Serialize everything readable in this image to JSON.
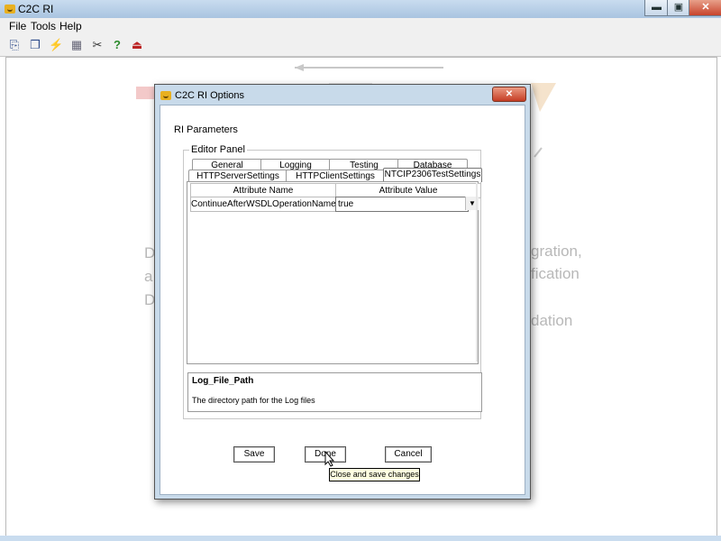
{
  "window": {
    "title": "C2C RI"
  },
  "titlebar_buttons": {
    "minimize": "▬",
    "maximize": "▣",
    "close": "✕"
  },
  "menu": {
    "items": [
      "File",
      "Tools",
      "Help"
    ]
  },
  "toolbar": {
    "icons": [
      "open-icon",
      "copy-icon",
      "wizard-icon",
      "report-icon",
      "tools-icon",
      "help-icon",
      "exit-icon"
    ],
    "glyphs": [
      "⎘",
      "❐",
      "⚡",
      "▦",
      "✂",
      "?",
      "⏏"
    ],
    "help_glyph_color": "#2a8a2a"
  },
  "background_slide": {
    "lines_right": [
      "gration,",
      "fication",
      "dation"
    ],
    "lines_left": [
      "D",
      "a",
      "D"
    ]
  },
  "dialog": {
    "title": "C2C RI Options",
    "section_label": "RI Parameters",
    "editor_panel_label": "Editor Panel",
    "tabs_row1": [
      "General",
      "Logging",
      "Testing",
      "Database"
    ],
    "tabs_row2": [
      "HTTPServerSettings",
      "HTTPClientSettings",
      "NTCIP2306TestSettings"
    ],
    "active_tab": "NTCIP2306TestSettings",
    "table": {
      "headers": [
        "Attribute Name",
        "Attribute Value"
      ],
      "rows": [
        {
          "name": "ContinueAfterWSDLOperationNameErrors",
          "value": "true"
        }
      ]
    },
    "description": {
      "title": "Log_File_Path",
      "text": "The directory path for the Log files"
    },
    "buttons": {
      "save": "Save",
      "done": "Done",
      "cancel": "Cancel"
    },
    "tooltip": "Close and save changes"
  }
}
